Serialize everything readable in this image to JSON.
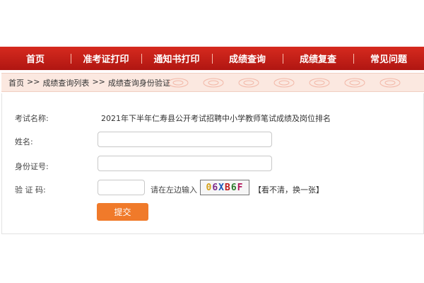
{
  "nav": {
    "items": [
      "首页",
      "准考证打印",
      "通知书打印",
      "成绩查询",
      "成绩复查",
      "常见问题"
    ]
  },
  "breadcrumb": {
    "home": "首页",
    "sep": ">>",
    "list": "成绩查询列表",
    "current": "成绩查询身份验证"
  },
  "form": {
    "exam_label": "考试名称:",
    "exam_value": "2021年下半年仁寿县公开考试招聘中小学教师笔试成绩及岗位排名",
    "name_label": "姓名:",
    "name_value": "",
    "id_label": "身份证号:",
    "id_value": "",
    "captcha_label": "验 证 码:",
    "captcha_value": "",
    "captcha_hint": "请在左边输入",
    "captcha_chars": [
      "0",
      "6",
      "X",
      "B",
      "6",
      "F"
    ],
    "captcha_colors": [
      "#d4a017",
      "#7b2a8a",
      "#1b57b8",
      "#c21b1b",
      "#2a7a2a",
      "#b0155a"
    ],
    "refresh_label": "【看不清，换一张】",
    "submit_label": "提交"
  },
  "colors": {
    "nav_bg": "#c41e17",
    "crumb_bg": "#fbe8e0",
    "submit_bg": "#f07a2a"
  }
}
